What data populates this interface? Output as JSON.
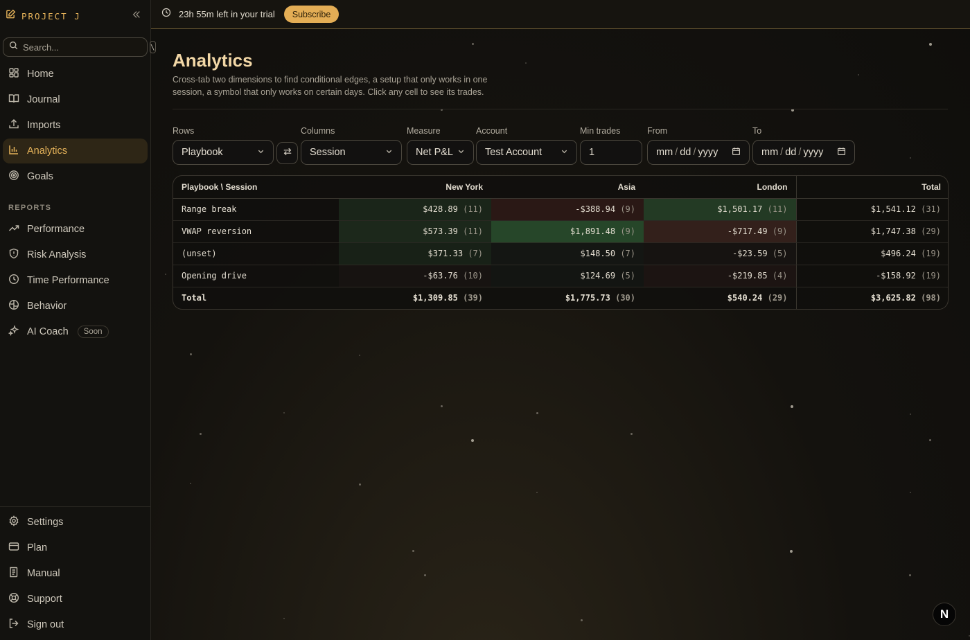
{
  "brand": {
    "name": "PROJECT J"
  },
  "search": {
    "placeholder": "Search...",
    "shortcut": "\\"
  },
  "nav": {
    "main": [
      {
        "label": "Home",
        "icon": "grid-icon"
      },
      {
        "label": "Journal",
        "icon": "book-icon"
      },
      {
        "label": "Imports",
        "icon": "upload-icon"
      },
      {
        "label": "Analytics",
        "icon": "bar-chart-icon",
        "active": true
      },
      {
        "label": "Goals",
        "icon": "target-icon"
      }
    ],
    "reports_label": "REPORTS",
    "reports": [
      {
        "label": "Performance",
        "icon": "trending-up-icon"
      },
      {
        "label": "Risk Analysis",
        "icon": "shield-icon"
      },
      {
        "label": "Time Performance",
        "icon": "clock-icon"
      },
      {
        "label": "Behavior",
        "icon": "brain-icon"
      },
      {
        "label": "AI Coach",
        "icon": "sparkles-icon",
        "badge": "Soon"
      }
    ],
    "bottom": [
      {
        "label": "Settings",
        "icon": "gear-icon"
      },
      {
        "label": "Plan",
        "icon": "credit-card-icon"
      },
      {
        "label": "Manual",
        "icon": "manual-icon"
      },
      {
        "label": "Support",
        "icon": "lifebuoy-icon"
      },
      {
        "label": "Sign out",
        "icon": "sign-out-icon"
      }
    ]
  },
  "topbar": {
    "trial_text": "23h 55m left in your trial",
    "subscribe_label": "Subscribe"
  },
  "page": {
    "title": "Analytics",
    "description": "Cross-tab two dimensions to find conditional edges, a setup that only works in one session, a symbol that only works on certain days. Click any cell to see its trades."
  },
  "filters": {
    "rows": {
      "label": "Rows",
      "value": "Playbook"
    },
    "columns": {
      "label": "Columns",
      "value": "Session"
    },
    "measure": {
      "label": "Measure",
      "value": "Net P&L"
    },
    "account": {
      "label": "Account",
      "value": "Test Account"
    },
    "min_trades": {
      "label": "Min trades",
      "value": "1"
    },
    "from": {
      "label": "From",
      "mm": "mm",
      "dd": "dd",
      "yyyy": "yyyy"
    },
    "to": {
      "label": "To",
      "mm": "mm",
      "dd": "dd",
      "yyyy": "yyyy"
    }
  },
  "table": {
    "corner": "Playbook \\ Session",
    "columns": [
      "New York",
      "Asia",
      "London",
      "Total"
    ],
    "rows": [
      {
        "label": "Range break",
        "cells": [
          {
            "value": "$428.89",
            "count": "(11)"
          },
          {
            "value": "-$388.94",
            "count": "(9)"
          },
          {
            "value": "$1,501.17",
            "count": "(11)"
          },
          {
            "value": "$1,541.12",
            "count": "(31)"
          }
        ]
      },
      {
        "label": "VWAP reversion",
        "cells": [
          {
            "value": "$573.39",
            "count": "(11)"
          },
          {
            "value": "$1,891.48",
            "count": "(9)"
          },
          {
            "value": "-$717.49",
            "count": "(9)"
          },
          {
            "value": "$1,747.38",
            "count": "(29)"
          }
        ]
      },
      {
        "label": "(unset)",
        "cells": [
          {
            "value": "$371.33",
            "count": "(7)"
          },
          {
            "value": "$148.50",
            "count": "(7)"
          },
          {
            "value": "-$23.59",
            "count": "(5)"
          },
          {
            "value": "$496.24",
            "count": "(19)"
          }
        ]
      },
      {
        "label": "Opening drive",
        "cells": [
          {
            "value": "-$63.76",
            "count": "(10)"
          },
          {
            "value": "$124.69",
            "count": "(5)"
          },
          {
            "value": "-$219.85",
            "count": "(4)"
          },
          {
            "value": "-$158.92",
            "count": "(19)"
          }
        ]
      },
      {
        "label": "Total",
        "cells": [
          {
            "value": "$1,309.85",
            "count": "(39)"
          },
          {
            "value": "$1,775.73",
            "count": "(30)"
          },
          {
            "value": "$540.24",
            "count": "(29)"
          },
          {
            "value": "$3,625.82",
            "count": "(98)"
          }
        ]
      }
    ]
  },
  "colors": {
    "accent": "#e6b35a",
    "positive": "#2f5a33",
    "negative": "#5a2a24"
  },
  "badge": {
    "letter": "N"
  }
}
